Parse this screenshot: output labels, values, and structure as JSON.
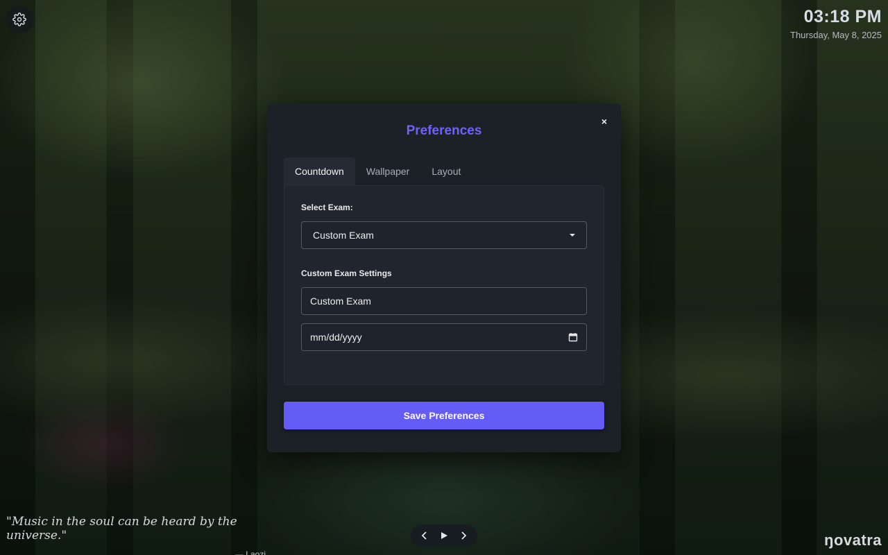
{
  "settings_icon": "gear-icon",
  "clock": {
    "time": "03:18 PM",
    "date": "Thursday, May 8, 2025"
  },
  "quote": {
    "text": "\"Music in the soul can be heard by the universe.\"",
    "author": "— Laozi"
  },
  "media": {
    "prev_icon": "chevron-left-icon",
    "play_icon": "play-icon",
    "next_icon": "chevron-right-icon"
  },
  "brand": "ŋovatra",
  "modal": {
    "title": "Preferences",
    "close_label": "×",
    "tabs": [
      {
        "label": "Countdown",
        "active": true
      },
      {
        "label": "Wallpaper",
        "active": false
      },
      {
        "label": "Layout",
        "active": false
      }
    ],
    "select_exam_label": "Select Exam:",
    "select_exam_value": "Custom Exam",
    "custom_settings_label": "Custom Exam Settings",
    "custom_name_value": "Custom Exam",
    "date_placeholder": "mm/dd/yyyy",
    "save_label": "Save Preferences"
  },
  "colors": {
    "accent": "#655bf7",
    "title": "#6e63f6",
    "modal_bg": "#1c2027",
    "panel_bg": "#21252d"
  }
}
